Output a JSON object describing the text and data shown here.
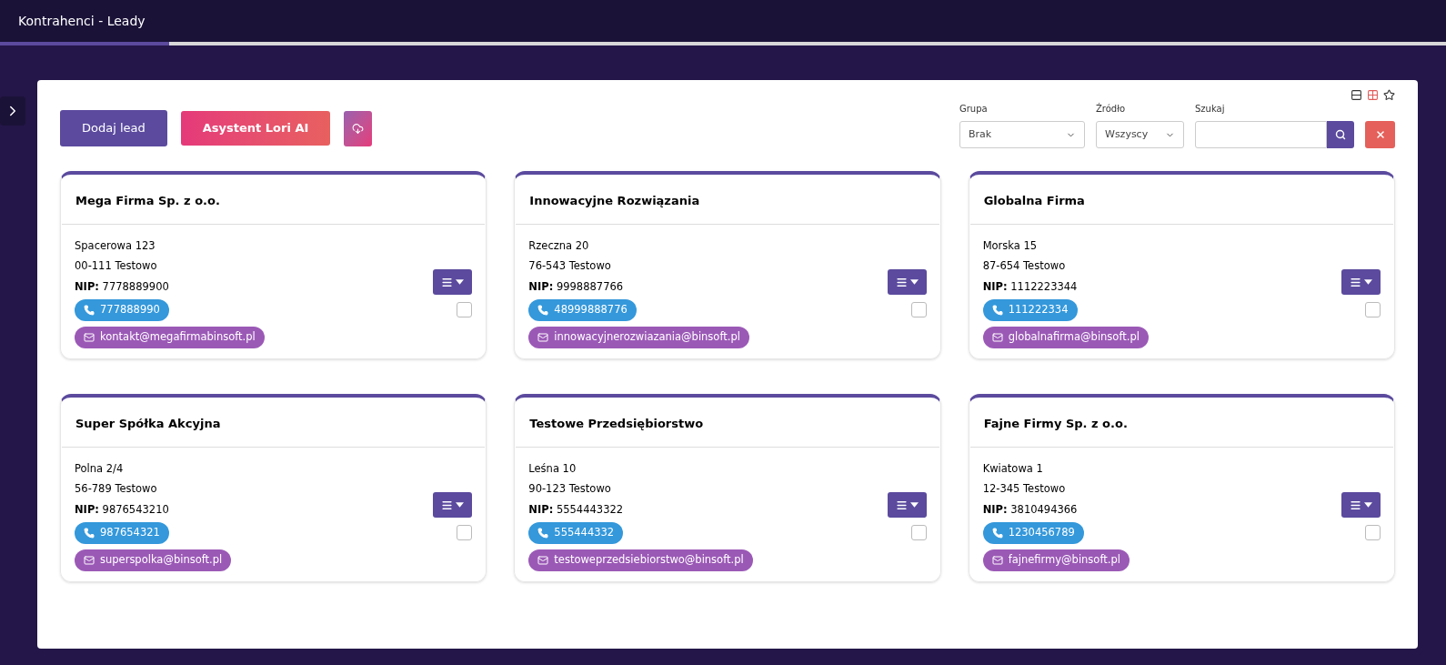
{
  "header": {
    "title": "Kontrahenci - Leady",
    "progress": {
      "level": 0.117
    }
  },
  "toolbar": {
    "buttons": [
      {
        "label": "Dodaj lead",
        "kind": "primary"
      },
      {
        "label": "Asystent Lori AI",
        "kind": "gradient"
      }
    ],
    "filters": [
      {
        "label": "Grupa",
        "value": "Brak",
        "kind": "select"
      },
      {
        "label": "Źródło",
        "value": "Wszyscy",
        "kind": "select"
      },
      {
        "label": "Szukaj",
        "kind": "search"
      }
    ]
  },
  "leads": [
    {
      "name": "Mega Firma Sp. z o.o.",
      "street": "Spacerowa 123",
      "city": "00-111 Testowo",
      "nip_label": "NIP:",
      "nip": "7778889900",
      "phone": "777888990",
      "email": "kontakt@megafirmabinsoft.pl",
      "checked": false
    },
    {
      "name": "Innowacyjne Rozwiązania",
      "street": "Rzeczna 20",
      "city": "76-543 Testowo",
      "nip_label": "NIP:",
      "nip": "9998887766",
      "phone": "48999888776",
      "email": "innowacyjnerozwiazania@binsoft.pl",
      "checked": false
    },
    {
      "name": "Globalna Firma",
      "street": "Morska 15",
      "city": "87-654 Testowo",
      "nip_label": "NIP:",
      "nip": "1112223344",
      "phone": "111222334",
      "email": "globalnafirma@binsoft.pl",
      "checked": false
    },
    {
      "name": "Super Spółka Akcyjna",
      "street": "Polna 2/4",
      "city": "56-789 Testowo",
      "nip_label": "NIP:",
      "nip": "9876543210",
      "phone": "987654321",
      "email": "superspolka@binsoft.pl",
      "checked": false
    },
    {
      "name": "Testowe Przedsiębiorstwo",
      "street": "Leśna 10",
      "city": "90-123 Testowo",
      "nip_label": "NIP:",
      "nip": "5554443322",
      "phone": "555444332",
      "email": "testoweprzedsiebiorstwo@binsoft.pl",
      "checked": false
    },
    {
      "name": "Fajne Firmy Sp. z o.o.",
      "street": "Kwiatowa 1",
      "city": "12-345 Testowo",
      "nip_label": "NIP:",
      "nip": "3810494366",
      "phone": "1230456789",
      "email": "fajnefirmy@binsoft.pl",
      "checked": false
    }
  ]
}
